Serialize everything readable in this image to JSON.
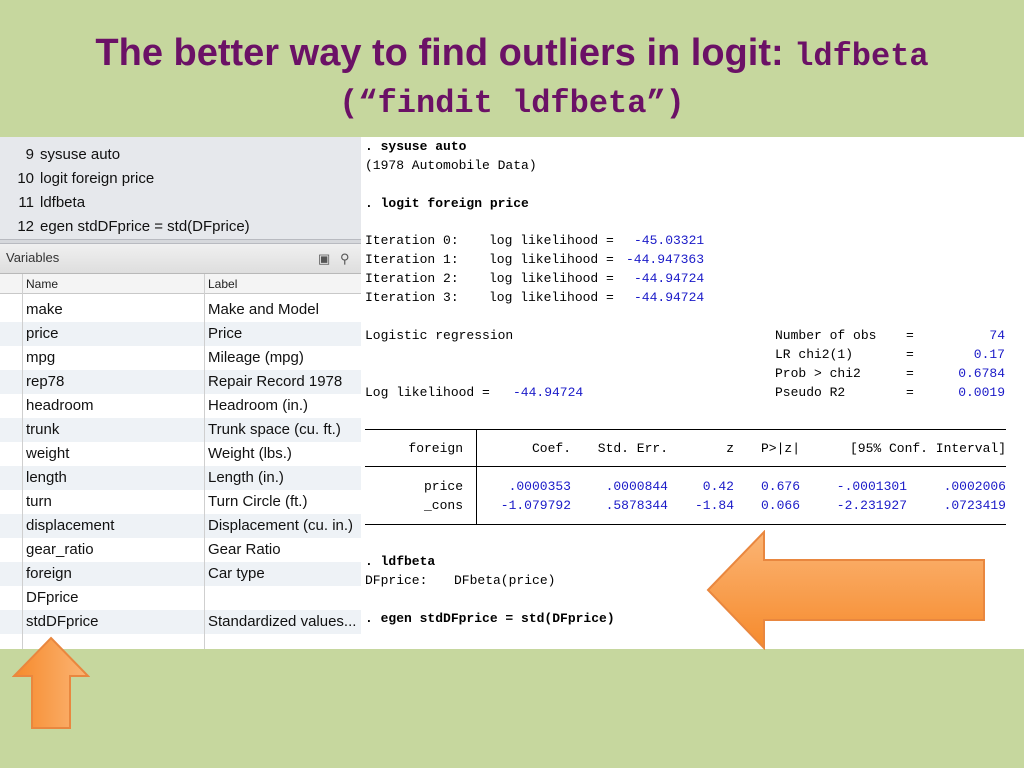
{
  "title": {
    "line1_text": "The better way to find outliers in logit: ",
    "line1_code": "ldfbeta",
    "line2": "(“findit ldfbeta”)"
  },
  "history": [
    {
      "num": "9",
      "cmd": "sysuse auto"
    },
    {
      "num": "10",
      "cmd": "logit foreign price"
    },
    {
      "num": "11",
      "cmd": "ldfbeta"
    },
    {
      "num": "12",
      "cmd": "egen stdDFprice = std(DFprice)"
    }
  ],
  "variables": {
    "title": "Variables",
    "col_name": "Name",
    "col_label": "Label",
    "rows": [
      {
        "name": "make",
        "label": "Make and Model"
      },
      {
        "name": "price",
        "label": "Price"
      },
      {
        "name": "mpg",
        "label": "Mileage (mpg)"
      },
      {
        "name": "rep78",
        "label": "Repair Record 1978"
      },
      {
        "name": "headroom",
        "label": "Headroom (in.)"
      },
      {
        "name": "trunk",
        "label": "Trunk space (cu. ft.)"
      },
      {
        "name": "weight",
        "label": "Weight (lbs.)"
      },
      {
        "name": "length",
        "label": "Length (in.)"
      },
      {
        "name": "turn",
        "label": "Turn Circle (ft.)"
      },
      {
        "name": "displacement",
        "label": "Displacement (cu. in.)"
      },
      {
        "name": "gear_ratio",
        "label": "Gear Ratio"
      },
      {
        "name": "foreign",
        "label": "Car type"
      },
      {
        "name": "DFprice",
        "label": ""
      },
      {
        "name": "stdDFprice",
        "label": "Standardized values..."
      }
    ]
  },
  "results": {
    "cmd1": ". sysuse auto",
    "out1": "(1978 Automobile Data)",
    "cmd2": ". logit foreign price",
    "iterations": [
      {
        "label": "Iteration 0:",
        "text": "log likelihood =",
        "val": "-45.03321"
      },
      {
        "label": "Iteration 1:",
        "text": "log likelihood =",
        "val": "-44.947363"
      },
      {
        "label": "Iteration 2:",
        "text": "log likelihood =",
        "val": "-44.94724"
      },
      {
        "label": "Iteration 3:",
        "text": "log likelihood =",
        "val": "-44.94724"
      }
    ],
    "model": "Logistic regression",
    "stats": [
      {
        "label": "Number of obs",
        "eq": "=",
        "val": "74"
      },
      {
        "label": "LR chi2(1)",
        "eq": "=",
        "val": "0.17"
      },
      {
        "label": "Prob > chi2",
        "eq": "=",
        "val": "0.6784"
      },
      {
        "label": "Pseudo R2",
        "eq": "=",
        "val": "0.0019"
      }
    ],
    "loglik_label": "Log likelihood =",
    "loglik_val": "-44.94724",
    "table": {
      "dep": "foreign",
      "headers": [
        "Coef.",
        "Std. Err.",
        "z",
        "P>|z|",
        "[95% Conf. Interval]"
      ],
      "rows": [
        {
          "var": "price",
          "vals": [
            ".0000353",
            ".0000844",
            "0.42",
            "0.676",
            "-.0001301",
            ".0002006"
          ]
        },
        {
          "var": "_cons",
          "vals": [
            "-1.079792",
            ".5878344",
            "-1.84",
            "0.066",
            "-2.231927",
            ".0723419"
          ]
        }
      ]
    },
    "cmd3": ". ldfbeta",
    "out3_label": "DFprice:",
    "out3_val": "DFbeta(price)",
    "cmd4": ". egen stdDFprice = std(DFprice)"
  },
  "colors": {
    "background": "#c6d79e",
    "title": "#6b1166",
    "arrow": "#f7923a",
    "stata_blue": "#1a1ac8"
  }
}
